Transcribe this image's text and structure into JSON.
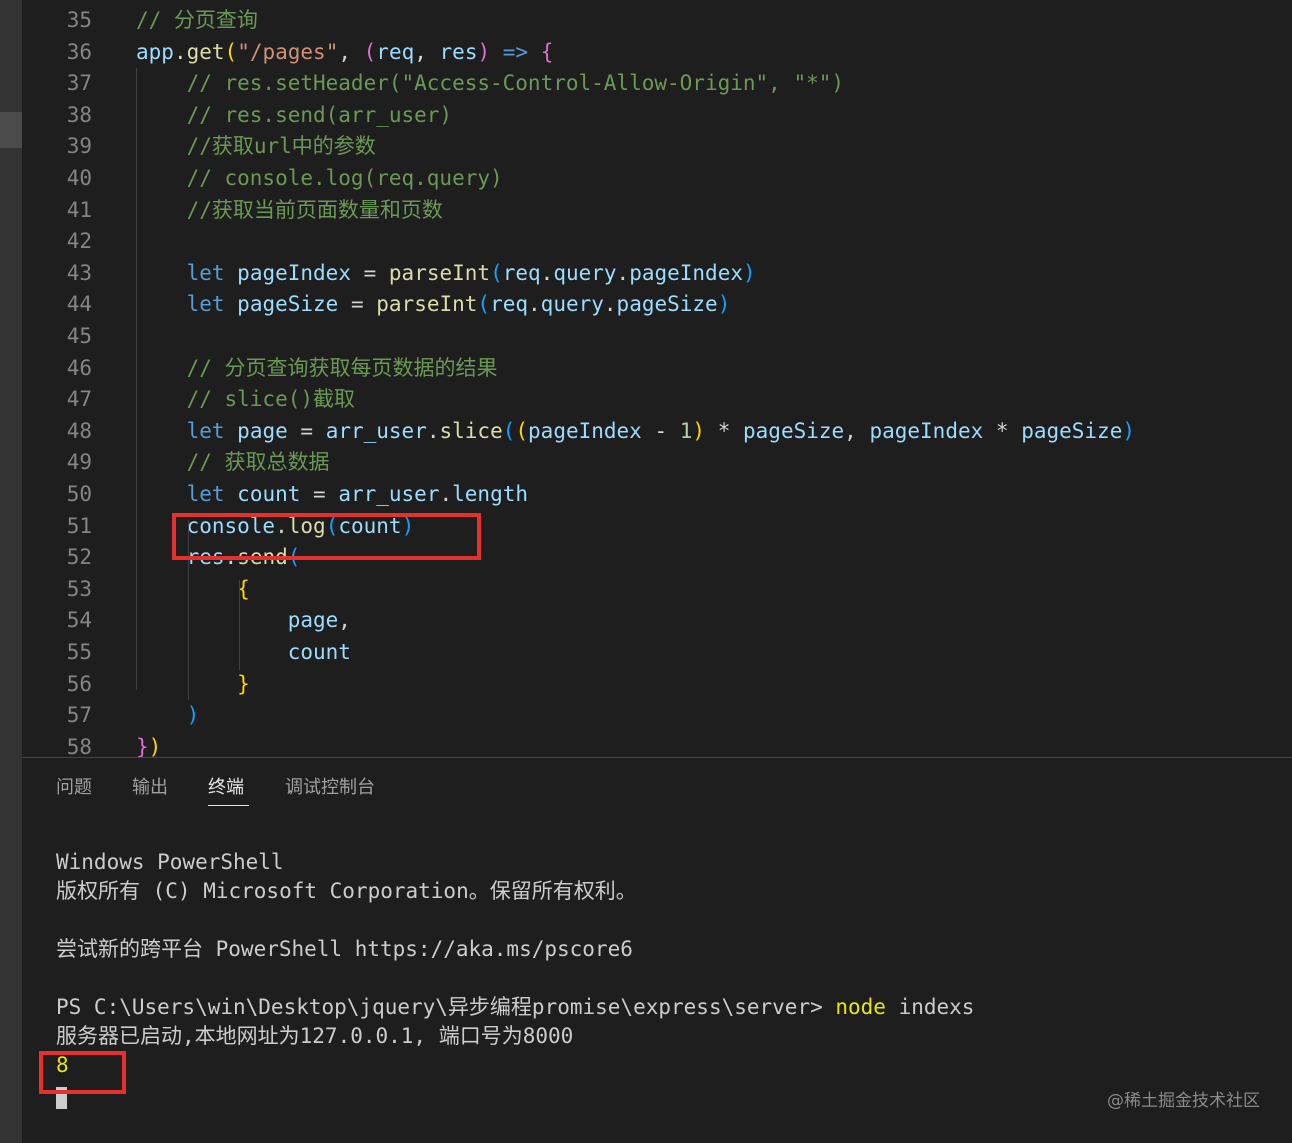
{
  "editor": {
    "lines": [
      {
        "n": "35",
        "tokens": [
          [
            "tok-comment",
            "// 分页查询"
          ]
        ]
      },
      {
        "n": "36",
        "tokens": [
          [
            "tok-var",
            "app"
          ],
          [
            "tok-plain",
            "."
          ],
          [
            "tok-func",
            "get"
          ],
          [
            "tok-brace1",
            "("
          ],
          [
            "tok-string",
            "\"/pages\""
          ],
          [
            "tok-plain",
            ", "
          ],
          [
            "tok-brace2",
            "("
          ],
          [
            "tok-var",
            "req"
          ],
          [
            "tok-plain",
            ", "
          ],
          [
            "tok-var",
            "res"
          ],
          [
            "tok-brace2",
            ")"
          ],
          [
            "tok-plain",
            " "
          ],
          [
            "tok-keyword",
            "=>"
          ],
          [
            "tok-plain",
            " "
          ],
          [
            "tok-brace2",
            "{"
          ]
        ]
      },
      {
        "n": "37",
        "tokens": [
          [
            "tok-comment",
            "    // res.setHeader(\"Access-Control-Allow-Origin\", \"*\")"
          ]
        ]
      },
      {
        "n": "38",
        "tokens": [
          [
            "tok-comment",
            "    // res.send(arr_user)"
          ]
        ]
      },
      {
        "n": "39",
        "tokens": [
          [
            "tok-comment",
            "    //获取url中的参数"
          ]
        ]
      },
      {
        "n": "40",
        "tokens": [
          [
            "tok-comment",
            "    // console.log(req.query)"
          ]
        ]
      },
      {
        "n": "41",
        "tokens": [
          [
            "tok-comment",
            "    //获取当前页面数量和页数"
          ]
        ]
      },
      {
        "n": "42",
        "tokens": []
      },
      {
        "n": "43",
        "tokens": [
          [
            "tok-plain",
            "    "
          ],
          [
            "tok-keyword",
            "let"
          ],
          [
            "tok-plain",
            " "
          ],
          [
            "tok-var",
            "pageIndex"
          ],
          [
            "tok-plain",
            " = "
          ],
          [
            "tok-func",
            "parseInt"
          ],
          [
            "tok-brace3",
            "("
          ],
          [
            "tok-var",
            "req"
          ],
          [
            "tok-plain",
            "."
          ],
          [
            "tok-var",
            "query"
          ],
          [
            "tok-plain",
            "."
          ],
          [
            "tok-var",
            "pageIndex"
          ],
          [
            "tok-brace3",
            ")"
          ]
        ]
      },
      {
        "n": "44",
        "tokens": [
          [
            "tok-plain",
            "    "
          ],
          [
            "tok-keyword",
            "let"
          ],
          [
            "tok-plain",
            " "
          ],
          [
            "tok-var",
            "pageSize"
          ],
          [
            "tok-plain",
            " = "
          ],
          [
            "tok-func",
            "parseInt"
          ],
          [
            "tok-brace3",
            "("
          ],
          [
            "tok-var",
            "req"
          ],
          [
            "tok-plain",
            "."
          ],
          [
            "tok-var",
            "query"
          ],
          [
            "tok-plain",
            "."
          ],
          [
            "tok-var",
            "pageSize"
          ],
          [
            "tok-brace3",
            ")"
          ]
        ]
      },
      {
        "n": "45",
        "tokens": []
      },
      {
        "n": "46",
        "tokens": [
          [
            "tok-comment",
            "    // 分页查询获取每页数据的结果"
          ]
        ]
      },
      {
        "n": "47",
        "tokens": [
          [
            "tok-comment",
            "    // slice()截取"
          ]
        ]
      },
      {
        "n": "48",
        "tokens": [
          [
            "tok-plain",
            "    "
          ],
          [
            "tok-keyword",
            "let"
          ],
          [
            "tok-plain",
            " "
          ],
          [
            "tok-var",
            "page"
          ],
          [
            "tok-plain",
            " = "
          ],
          [
            "tok-var",
            "arr_user"
          ],
          [
            "tok-plain",
            "."
          ],
          [
            "tok-func",
            "slice"
          ],
          [
            "tok-brace3",
            "("
          ],
          [
            "tok-brace1",
            "("
          ],
          [
            "tok-var",
            "pageIndex"
          ],
          [
            "tok-plain",
            " - "
          ],
          [
            "tok-number",
            "1"
          ],
          [
            "tok-brace1",
            ")"
          ],
          [
            "tok-plain",
            " * "
          ],
          [
            "tok-var",
            "pageSize"
          ],
          [
            "tok-plain",
            ", "
          ],
          [
            "tok-var",
            "pageIndex"
          ],
          [
            "tok-plain",
            " * "
          ],
          [
            "tok-var",
            "pageSize"
          ],
          [
            "tok-brace3",
            ")"
          ]
        ]
      },
      {
        "n": "49",
        "tokens": [
          [
            "tok-comment",
            "    // 获取总数据"
          ]
        ]
      },
      {
        "n": "50",
        "tokens": [
          [
            "tok-plain",
            "    "
          ],
          [
            "tok-keyword",
            "let"
          ],
          [
            "tok-plain",
            " "
          ],
          [
            "tok-var",
            "count"
          ],
          [
            "tok-plain",
            " = "
          ],
          [
            "tok-var",
            "arr_user"
          ],
          [
            "tok-plain",
            "."
          ],
          [
            "tok-var",
            "length"
          ]
        ]
      },
      {
        "n": "51",
        "tokens": [
          [
            "tok-plain",
            "    "
          ],
          [
            "tok-var",
            "console"
          ],
          [
            "tok-plain",
            "."
          ],
          [
            "tok-func",
            "log"
          ],
          [
            "tok-brace3",
            "("
          ],
          [
            "tok-var",
            "count"
          ],
          [
            "tok-brace3",
            ")"
          ]
        ]
      },
      {
        "n": "52",
        "tokens": [
          [
            "tok-plain",
            "    "
          ],
          [
            "tok-var",
            "res"
          ],
          [
            "tok-plain",
            "."
          ],
          [
            "tok-func",
            "send"
          ],
          [
            "tok-brace3",
            "("
          ]
        ]
      },
      {
        "n": "53",
        "tokens": [
          [
            "tok-plain",
            "        "
          ],
          [
            "tok-brace1",
            "{"
          ]
        ]
      },
      {
        "n": "54",
        "tokens": [
          [
            "tok-plain",
            "            "
          ],
          [
            "tok-var",
            "page"
          ],
          [
            "tok-plain",
            ","
          ]
        ]
      },
      {
        "n": "55",
        "tokens": [
          [
            "tok-plain",
            "            "
          ],
          [
            "tok-var",
            "count"
          ]
        ]
      },
      {
        "n": "56",
        "tokens": [
          [
            "tok-plain",
            "        "
          ],
          [
            "tok-brace1",
            "}"
          ]
        ]
      },
      {
        "n": "57",
        "tokens": [
          [
            "tok-plain",
            "    "
          ],
          [
            "tok-brace3",
            ")"
          ]
        ]
      },
      {
        "n": "58",
        "tokens": [
          [
            "tok-brace2",
            "}"
          ],
          [
            "tok-brace1",
            ")"
          ]
        ]
      }
    ]
  },
  "panel": {
    "tabs": [
      "问题",
      "输出",
      "终端",
      "调试控制台"
    ],
    "active_tab": "终端",
    "terminal": {
      "line1": "Windows PowerShell",
      "line2": "版权所有 (C) Microsoft Corporation。保留所有权利。",
      "line3": "尝试新的跨平台 PowerShell https://aka.ms/pscore6",
      "prompt": "PS C:\\Users\\win\\Desktop\\jquery\\异步编程promise\\express\\server> ",
      "command": "node",
      "command_arg": " indexs",
      "server_msg": "服务器已启动,本地网址为127.0.0.1, 端口号为8000",
      "output": "8"
    }
  },
  "watermark": "@稀土掘金技术社区",
  "colors": {
    "highlight": "#e5302c",
    "background": "#1e1e1e"
  }
}
